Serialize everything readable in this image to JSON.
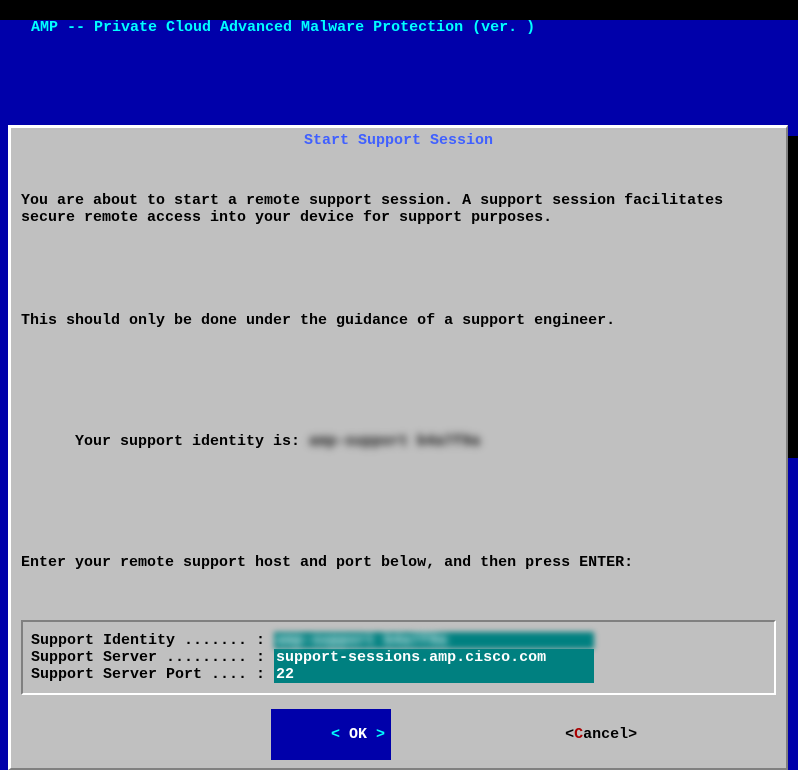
{
  "header": {
    "title": " AMP -- Private Cloud Advanced Malware Protection (ver. )"
  },
  "dialog": {
    "title": "Start Support Session",
    "line1": "You are about to start a remote support session. A support session facilitates secure remote access into your device for support purposes.",
    "line2": "This should only be done under the guidance of a support engineer.",
    "identity_prefix": "Your support identity is: ",
    "identity_value_obscured": "amp-support b4a7f9a",
    "line4": "Enter your remote support host and port below, and then press ENTER:"
  },
  "form": {
    "rows": [
      {
        "label": "Support Identity ....... : ",
        "value": "amp-support b4a7f9a",
        "obscured": true
      },
      {
        "label": "Support Server ......... : ",
        "value": "support-sessions.amp.cisco.com"
      },
      {
        "label": "Support Server Port .... : ",
        "value": "22"
      }
    ]
  },
  "buttons": {
    "ok_left": "<",
    "ok_label": " OK ",
    "ok_right": ">",
    "cancel_open": "<",
    "cancel_hot": "C",
    "cancel_rest": "ancel",
    "cancel_close": ">"
  }
}
